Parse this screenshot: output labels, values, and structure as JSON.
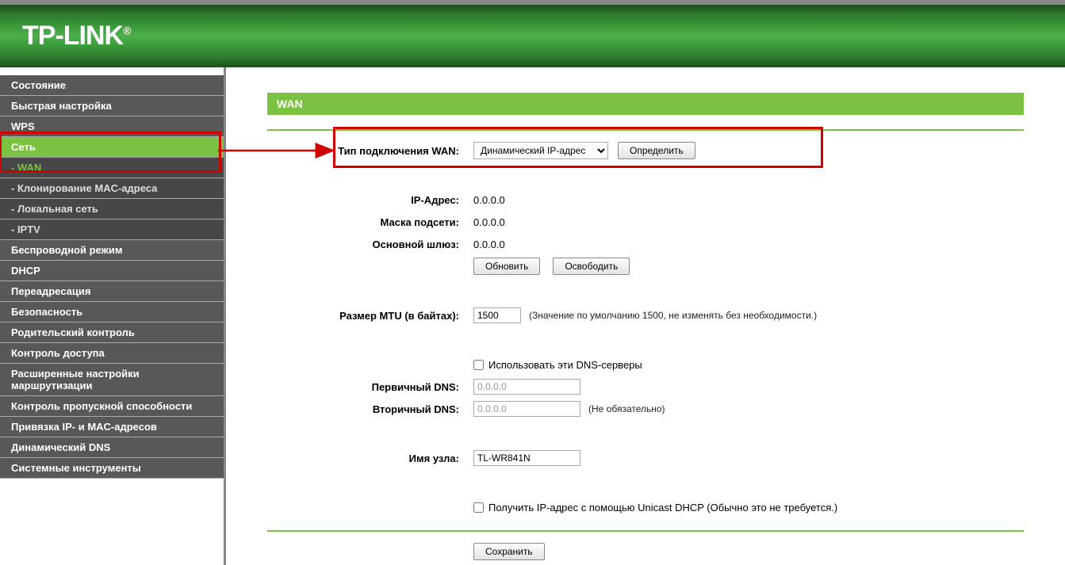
{
  "brand": "TP-LINK",
  "sidebar": {
    "items": [
      {
        "label": "Состояние",
        "type": "top"
      },
      {
        "label": "Быстрая настройка",
        "type": "top"
      },
      {
        "label": "WPS",
        "type": "top"
      },
      {
        "label": "Сеть",
        "type": "active-parent"
      },
      {
        "label": "- WAN",
        "type": "active-sub"
      },
      {
        "label": "- Клонирование MAC-адреса",
        "type": "sub"
      },
      {
        "label": "- Локальная сеть",
        "type": "sub"
      },
      {
        "label": "- IPTV",
        "type": "sub"
      },
      {
        "label": "Беспроводной режим",
        "type": "top"
      },
      {
        "label": "DHCP",
        "type": "top"
      },
      {
        "label": "Переадресация",
        "type": "top"
      },
      {
        "label": "Безопасность",
        "type": "top"
      },
      {
        "label": "Родительский контроль",
        "type": "top"
      },
      {
        "label": "Контроль доступа",
        "type": "top"
      },
      {
        "label": "Расширенные настройки маршрутизации",
        "type": "top"
      },
      {
        "label": "Контроль пропускной способности",
        "type": "top"
      },
      {
        "label": "Привязка IP- и MAC-адресов",
        "type": "top"
      },
      {
        "label": "Динамический DNS",
        "type": "top"
      },
      {
        "label": "Системные инструменты",
        "type": "top"
      }
    ]
  },
  "page": {
    "title": "WAN",
    "labels": {
      "conn_type": "Тип подключения WAN:",
      "ip": "IP-Адрес:",
      "mask": "Маска подсети:",
      "gw": "Основной шлюз:",
      "mtu": "Размер MTU (в байтах):",
      "dns1": "Первичный DNS:",
      "dns2": "Вторичный DNS:",
      "host": "Имя узла:"
    },
    "values": {
      "conn_type_selected": "Динамический IP-адрес",
      "ip": "0.0.0.0",
      "mask": "0.0.0.0",
      "gw": "0.0.0.0",
      "mtu": "1500",
      "dns1_ph": "0.0.0.0",
      "dns2_ph": "0.0.0.0",
      "host": "TL-WR841N"
    },
    "buttons": {
      "detect": "Определить",
      "renew": "Обновить",
      "release": "Освободить",
      "save": "Сохранить"
    },
    "hints": {
      "mtu": "(Значение по умолчанию 1500, не изменять без необходимости.)",
      "dns2": "(Не обязательно)",
      "use_dns": "Использовать эти DNS-серверы",
      "unicast": "Получить IP-адрес с помощью Unicast DHCP (Обычно это не требуется.)"
    }
  }
}
